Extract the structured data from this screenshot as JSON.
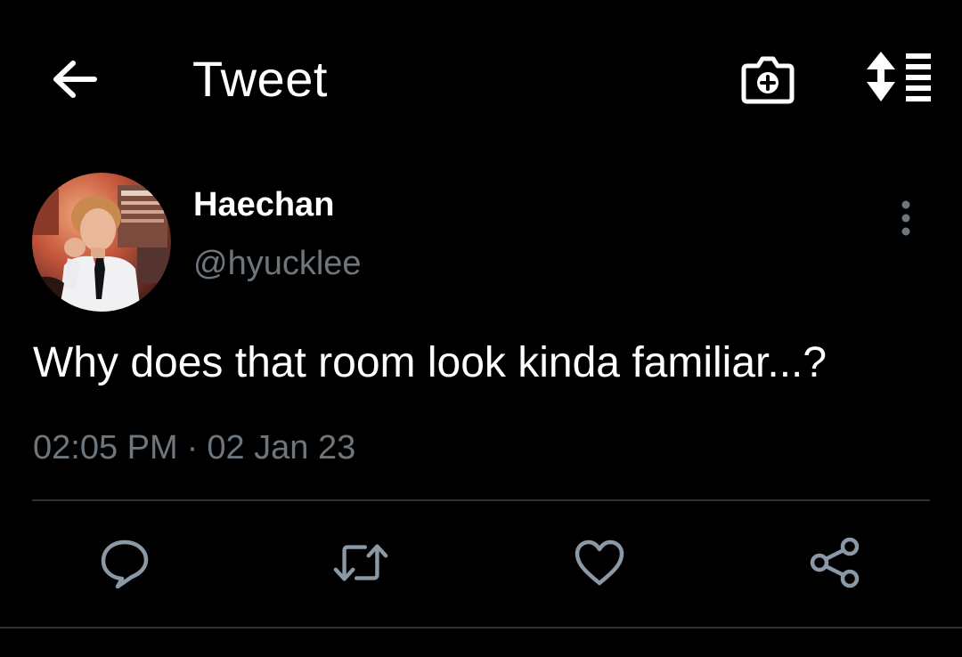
{
  "header": {
    "title": "Tweet",
    "back_icon": "arrow-left-icon",
    "camera_icon": "camera-plus-icon",
    "sort_icon": "sort-list-icon"
  },
  "author": {
    "name": "Haechan",
    "handle": "@hyucklee",
    "avatar_icon": "profile-photo",
    "more_icon": "more-vertical-icon"
  },
  "tweet": {
    "text": "Why does that room look kinda familiar...?",
    "time": "02:05 PM",
    "separator": "·",
    "date": "02 Jan 23"
  },
  "actions": {
    "reply_icon": "reply-bubble-icon",
    "retweet_icon": "retweet-icon",
    "like_icon": "heart-icon",
    "share_icon": "share-icon"
  },
  "colors": {
    "background": "#000000",
    "primary_text": "#ffffff",
    "secondary_text": "#6e767d",
    "divider": "#2f3336",
    "action_icon": "#8b98a5"
  }
}
